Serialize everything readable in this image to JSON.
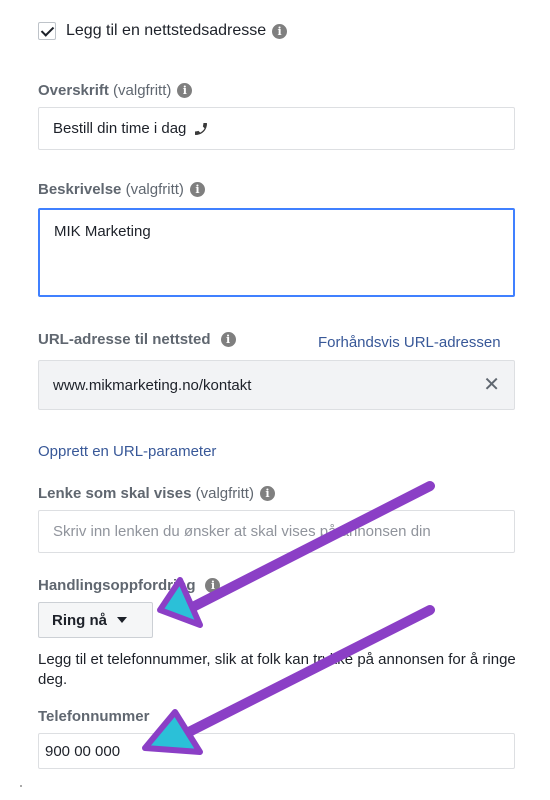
{
  "website": {
    "checkbox_label": "Legg til en nettstedsadresse"
  },
  "headline": {
    "label": "Overskrift",
    "optional": "(valgfritt)",
    "value": "Bestill din time i dag"
  },
  "description": {
    "label": "Beskrivelse",
    "optional": "(valgfritt)",
    "value": "MIK Marketing"
  },
  "url": {
    "label": "URL-adresse til nettsted",
    "preview_link": "Forhåndsvis URL-adressen",
    "value": "www.mikmarketing.no/kontakt",
    "clear_symbol": "✕"
  },
  "url_parameter_link": "Opprett en URL-parameter",
  "display_link": {
    "label": "Lenke som skal vises",
    "optional": "(valgfritt)",
    "placeholder": "Skriv inn lenken du ønsker at skal vises på annonsen din"
  },
  "cta": {
    "label": "Handlingsoppfordring",
    "selected": "Ring nå"
  },
  "phone": {
    "helper_text": "Legg til et telefonnummer, slik at folk kan trykke på annonsen for å ringe deg.",
    "label": "Telefonnummer",
    "value": "900 00 000"
  },
  "info_glyph": "i",
  "colors": {
    "arrow": "#8b3fc6",
    "arrow_head": "#2bc0d8",
    "link": "#385898",
    "focus_border": "#4080ff"
  },
  "icons": [
    "check-icon",
    "info-icon",
    "phone-icon",
    "close-icon",
    "caret-down-icon",
    "annotation-arrow"
  ]
}
